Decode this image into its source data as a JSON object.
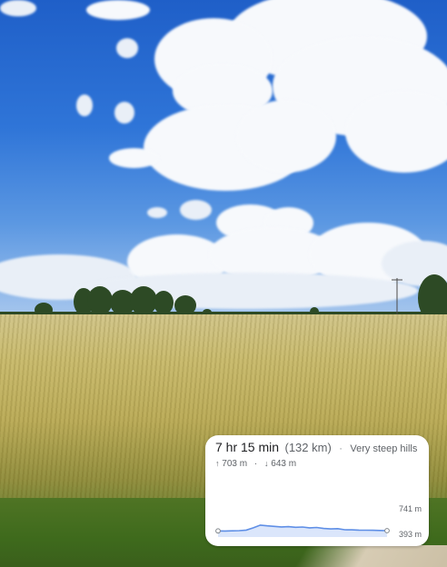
{
  "route_card": {
    "duration": "7 hr 15 min",
    "distance": "(132 km)",
    "separator": "·",
    "terrain": "Very steep hills",
    "ascent_icon": "arrow-up-icon",
    "ascent": "703 m",
    "descent_icon": "arrow-down-icon",
    "descent": "643 m",
    "max_elevation_label": "741 m",
    "min_elevation_label": "393 m"
  },
  "elevation_profile": {
    "min_m": 393,
    "max_m": 741,
    "samples": [
      401,
      399,
      402,
      404,
      410,
      438,
      470,
      462,
      455,
      448,
      452,
      444,
      447,
      438,
      442,
      430,
      424,
      428,
      415,
      414,
      410,
      409,
      408,
      406,
      404
    ],
    "line_color": "#5f8fe6",
    "fill_color": "#dbe6fb"
  }
}
